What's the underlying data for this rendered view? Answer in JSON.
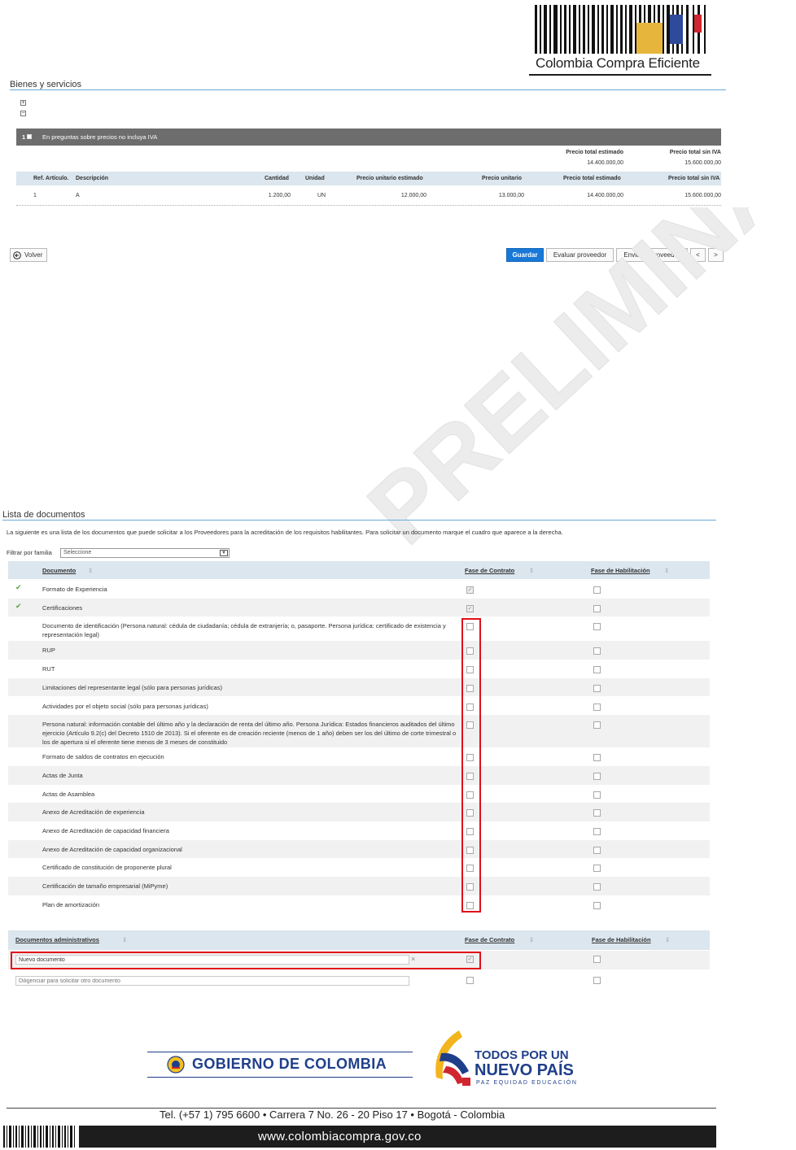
{
  "header": {
    "logo_text": "Colombia Compra Eficiente"
  },
  "bienes": {
    "title": "Bienes y servicios",
    "expand_icon": "+",
    "collapse_icon": "−",
    "group_number": "1",
    "group_text": "En preguntas sobre precios no incluya IVA",
    "summary_labels": [
      "Precio total estimado",
      "Precio total sin IVA"
    ],
    "summary_values": [
      "14.400.000,00",
      "15.600.000,00"
    ],
    "columns": [
      "Ref. Artículo.",
      "Descripción",
      "Cantidad",
      "Unidad",
      "Precio unitario estimado",
      "Precio unitario",
      "Precio total estimado",
      "Precio total sin IVA"
    ],
    "rows": [
      [
        "1",
        "A",
        "1.200,00",
        "UN",
        "12.000,00",
        "13.000,00",
        "14.400.000,00",
        "15.600.000,00"
      ]
    ]
  },
  "actions": {
    "back": "Volver",
    "save": "Guardar",
    "evaluate": "Evaluar proveedor",
    "send": "Enviar al proveedor",
    "prev": "<",
    "next": ">"
  },
  "watermark": "PRELIMINAR",
  "documentos": {
    "title": "Lista de documentos",
    "intro": "La siguiente es una lista de los documentos que puede solicitar a los Proveedores para la acreditación de los requisitos habilitantes. Para solicitar un documento marque el cuadro que aparece a la derecha.",
    "filter_label": "Filtrar por familia",
    "filter_value": "Seleccione",
    "columns": [
      "Documento",
      "Fase de Contrato",
      "Fase de Habilitación"
    ],
    "rows": [
      {
        "label": "Formato de Experiencia",
        "selected": true,
        "contrato": true,
        "habilitacion": false
      },
      {
        "label": "Certificaciones",
        "selected": true,
        "contrato": true,
        "habilitacion": false
      },
      {
        "label": "Documento de identificación (Persona natural: cédula de ciudadanía; cédula de extranjería; o, pasaporte. Persona jurídica: certificado de existencia y representación legal)",
        "selected": false,
        "contrato": false,
        "habilitacion": false
      },
      {
        "label": "RUP",
        "selected": false,
        "contrato": false,
        "habilitacion": false
      },
      {
        "label": "RUT",
        "selected": false,
        "contrato": false,
        "habilitacion": false
      },
      {
        "label": "Limitaciones del representante legal (sólo para personas jurídicas)",
        "selected": false,
        "contrato": false,
        "habilitacion": false
      },
      {
        "label": "Actividades por el objeto social (sólo para personas jurídicas)",
        "selected": false,
        "contrato": false,
        "habilitacion": false
      },
      {
        "label": "Persona natural: información contable del último año y la declaración de renta del último año. Persona Jurídica: Estados financieros auditados del último ejercicio (Artículo 9.2(c) del Decreto 1510 de 2013). Si el oferente es de creación reciente (menos de 1 año) deben ser los del último de corte trimestral o los de apertura si el oferente tiene menos de 3 meses de constituido",
        "selected": false,
        "contrato": false,
        "habilitacion": false
      },
      {
        "label": "Formato de saldos de contratos en ejecución",
        "selected": false,
        "contrato": false,
        "habilitacion": false
      },
      {
        "label": "Actas de Junta",
        "selected": false,
        "contrato": false,
        "habilitacion": false
      },
      {
        "label": "Actas de Asamblea",
        "selected": false,
        "contrato": false,
        "habilitacion": false
      },
      {
        "label": "Anexo de Acreditación de experiencia",
        "selected": false,
        "contrato": false,
        "habilitacion": false
      },
      {
        "label": "Anexo de Acreditación de capacidad financiera",
        "selected": false,
        "contrato": false,
        "habilitacion": false
      },
      {
        "label": "Anexo de Acreditación de capacidad organizacional",
        "selected": false,
        "contrato": false,
        "habilitacion": false
      },
      {
        "label": "Certificado de constitución de proponente plural",
        "selected": false,
        "contrato": false,
        "habilitacion": false
      },
      {
        "label": "Certificación de tamaño empresarial (MiPyme)",
        "selected": false,
        "contrato": false,
        "habilitacion": false
      },
      {
        "label": "Plan de amortización",
        "selected": false,
        "contrato": false,
        "habilitacion": false
      }
    ]
  },
  "administrativos": {
    "columns": [
      "Documentos administrativos",
      "Fase de Contrato",
      "Fase de Habilitación"
    ],
    "new_doc_value": "Nuevo documento",
    "clear_icon": "×",
    "other_placeholder": "Diligenciar para solicitar otro documento"
  },
  "footer": {
    "gob": "GOBIERNO DE COLOMBIA",
    "todos1": "TODOS POR UN",
    "todos2": "NUEVO PAÍS",
    "todos3": "PAZ  EQUIDAD  EDUCACIÓN",
    "tel": "Tel. (+57 1) 795 6600 • Carrera 7 No. 26 - 20 Piso 17 • Bogotá - Colombia",
    "web": "www.colombiacompra.gov.co"
  },
  "colors": {
    "primary_button": "#1878d8",
    "section_rule": "#6aa9d8",
    "header_bg": "#dbe6ee",
    "highlight": "#e0101a",
    "check_green": "#5ba33d"
  }
}
